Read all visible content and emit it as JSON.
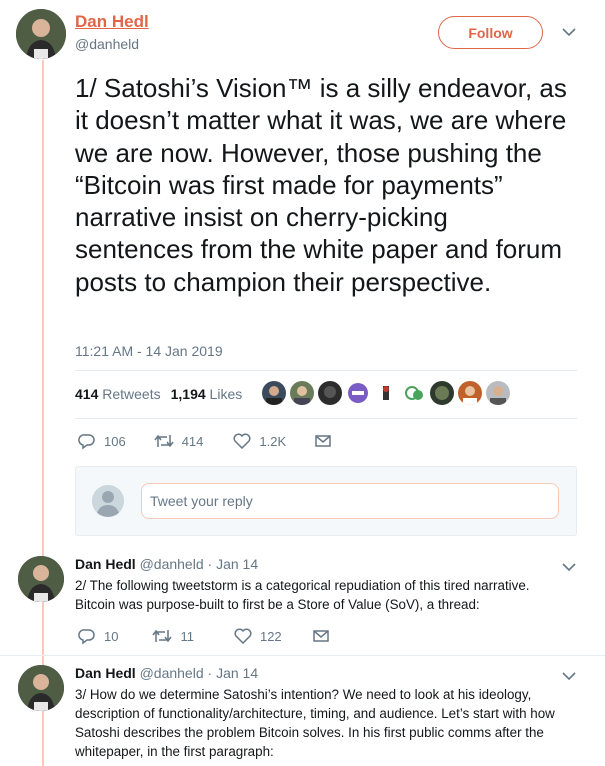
{
  "main_tweet": {
    "author_name": "Dan Hedl",
    "handle": "@danheld",
    "follow_label": "Follow",
    "text": "1/ Satoshi’s Vision™ is a silly endeavor, as it doesn’t matter what it was, we are where we are now. However, those pushing the “Bitcoin was first made for payments” narrative insist on cherry-picking sentences from the white paper and forum posts to champion their perspective.",
    "timestamp": "11:21 AM - 14 Jan 2019",
    "retweets_count": "414",
    "retweets_label": "Retweets",
    "likes_count": "1,194",
    "likes_label": "Likes",
    "actions": {
      "replies": "106",
      "retweets": "414",
      "likes": "1.2K"
    }
  },
  "liker_avatars": [
    "#3b4a5c",
    "#6a7b5a",
    "#2c2c2c",
    "#7a5cc4",
    "#b0b0b0",
    "#4aa35a",
    "#2e3a2e",
    "#c0612b",
    "#707070"
  ],
  "reply_box": {
    "placeholder": "Tweet your reply"
  },
  "thread": [
    {
      "author_name": "Dan Hedl",
      "handle": "@danheld",
      "date": "· Jan 14",
      "text": "2/ The following tweetstorm is a categorical repudiation of this tired narrative. Bitcoin was purpose-built to first be a Store of Value (SoV), a thread:",
      "actions": {
        "replies": "10",
        "retweets": "11",
        "likes": "122"
      }
    },
    {
      "author_name": "Dan Hedl",
      "handle": "@danheld",
      "date": "· Jan 14",
      "text": "3/ How do we determine Satoshi’s intention? We need to look at his ideology, description of functionality/architecture, timing, and audience. Let’s start with how Satoshi describes the problem Bitcoin solves. In his first public comms after the whitepaper, in the first paragraph:"
    }
  ],
  "colors": {
    "accent": "#e0664a",
    "muted": "#657786",
    "thread_line": "#fbc9bb"
  }
}
